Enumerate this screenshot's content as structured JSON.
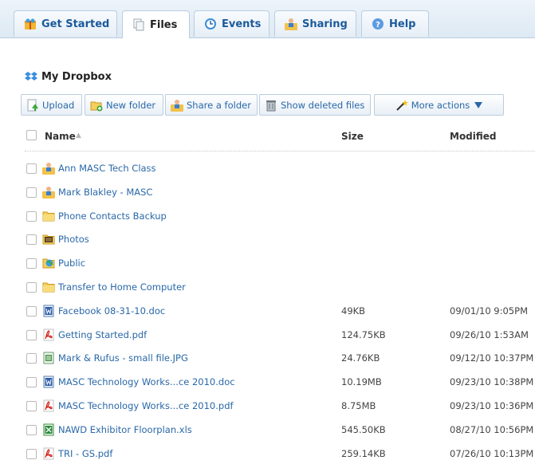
{
  "tabs": [
    {
      "label": "Get Started",
      "icon": "get-started-icon"
    },
    {
      "label": "Files",
      "icon": "files-icon",
      "active": true
    },
    {
      "label": "Events",
      "icon": "events-icon"
    },
    {
      "label": "Sharing",
      "icon": "sharing-icon"
    },
    {
      "label": "Help",
      "icon": "help-icon"
    }
  ],
  "header": {
    "title": "My Dropbox",
    "icon": "dropbox-icon"
  },
  "toolbar": {
    "upload": "Upload",
    "new_folder": "New folder",
    "share_folder": "Share a folder",
    "show_deleted": "Show deleted files",
    "more_actions": "More actions"
  },
  "columns": {
    "name": "Name",
    "size": "Size",
    "modified": "Modified"
  },
  "files": [
    {
      "name": "Ann MASC Tech Class",
      "type": "shared-folder",
      "size": "",
      "modified": ""
    },
    {
      "name": "Mark Blakley - MASC",
      "type": "shared-folder",
      "size": "",
      "modified": ""
    },
    {
      "name": "Phone Contacts Backup",
      "type": "folder",
      "size": "",
      "modified": ""
    },
    {
      "name": "Photos",
      "type": "photos-folder",
      "size": "",
      "modified": ""
    },
    {
      "name": "Public",
      "type": "public-folder",
      "size": "",
      "modified": ""
    },
    {
      "name": "Transfer to Home Computer",
      "type": "folder",
      "size": "",
      "modified": ""
    },
    {
      "name": "Facebook 08-31-10.doc",
      "type": "word",
      "size": "49KB",
      "modified": "09/01/10  9:05PM"
    },
    {
      "name": "Getting Started.pdf",
      "type": "pdf",
      "size": "124.75KB",
      "modified": "09/26/10  1:53AM"
    },
    {
      "name": "Mark & Rufus - small file.JPG",
      "type": "image",
      "size": "24.76KB",
      "modified": "09/12/10  10:37PM"
    },
    {
      "name": "MASC Technology Works...ce 2010.doc",
      "type": "word",
      "size": "10.19MB",
      "modified": "09/23/10  10:38PM"
    },
    {
      "name": "MASC Technology Works...ce 2010.pdf",
      "type": "pdf",
      "size": "8.75MB",
      "modified": "09/23/10  10:36PM"
    },
    {
      "name": "NAWD Exhibitor Floorplan.xls",
      "type": "excel",
      "size": "545.50KB",
      "modified": "08/27/10  10:56PM"
    },
    {
      "name": "TRI - GS.pdf",
      "type": "pdf",
      "size": "259.14KB",
      "modified": "07/26/10  10:13PM"
    }
  ],
  "colors": {
    "link": "#2a68a8",
    "tabbar": "#dde9f3",
    "border": "#b8cde0"
  }
}
